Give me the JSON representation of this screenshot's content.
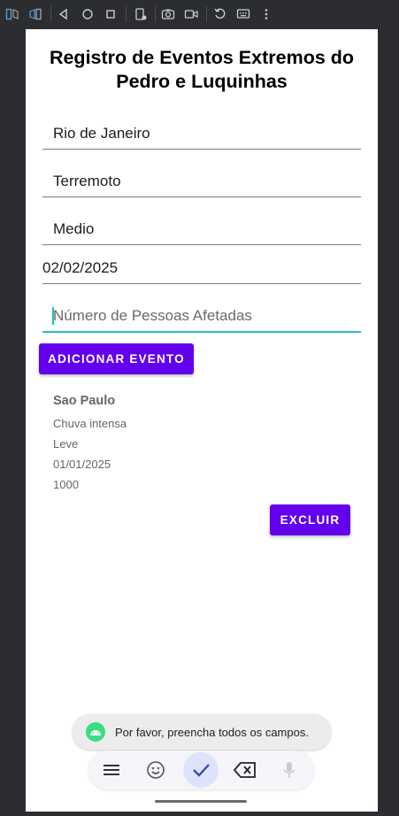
{
  "app": {
    "title": "Registro de Eventos Extremos do Pedro e Luquinhas"
  },
  "form": {
    "location_value": "Rio de Janeiro",
    "event_type_value": "Terremoto",
    "severity_value": "Medio",
    "date_value": "02/02/2025",
    "people_placeholder": "Número de Pessoas Afetadas",
    "add_button_label": "ADICIONAR EVENTO"
  },
  "events": [
    {
      "city": "Sao Paulo",
      "event_type": "Chuva intensa",
      "severity": "Leve",
      "date": "01/01/2025",
      "people": "1000",
      "delete_label": "EXCLUIR"
    }
  ],
  "toast": {
    "message": "Por favor, preencha todos os campos."
  },
  "colors": {
    "primary": "#6200ee",
    "accent": "#1fbfbf",
    "android_green": "#3ddc84"
  },
  "toolbar_icons": [
    "fold-icon",
    "unfold-icon",
    "back-icon",
    "home-icon",
    "overview-icon",
    "rotate-device-icon",
    "screenshot-icon",
    "record-icon",
    "undo-icon",
    "keyboard-icon",
    "more-icon"
  ],
  "keyboard_icons": [
    "menu-icon",
    "emoji-icon",
    "check-icon",
    "backspace-icon",
    "mic-icon"
  ]
}
